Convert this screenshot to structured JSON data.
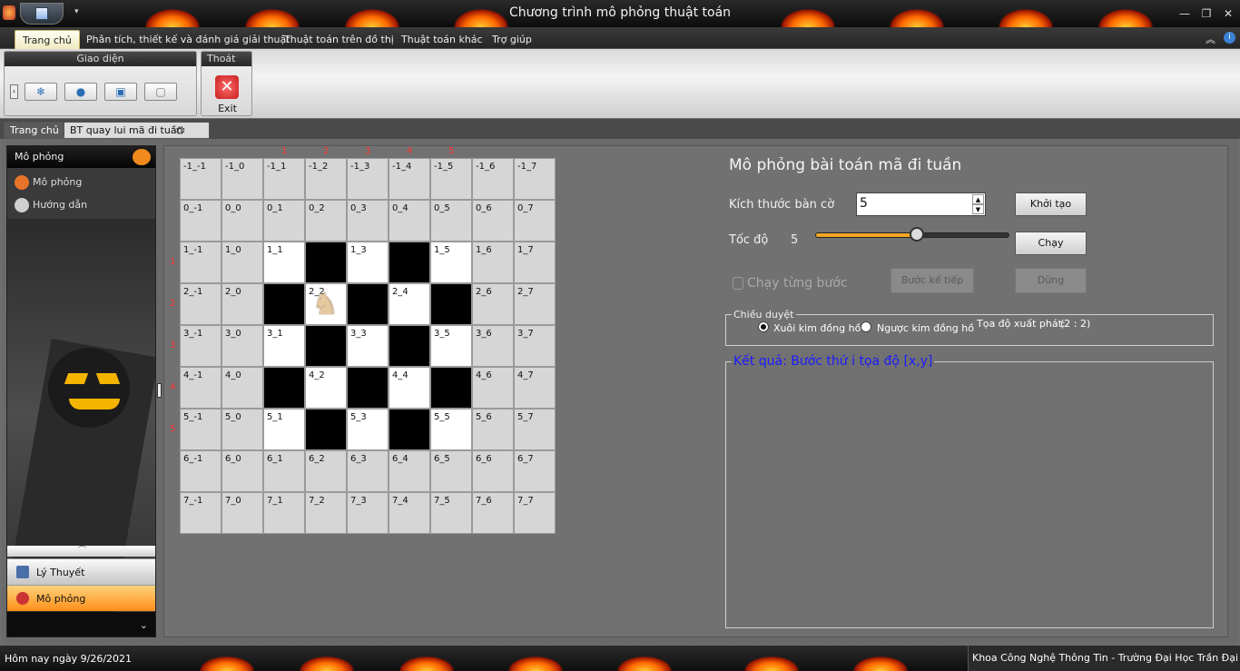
{
  "window": {
    "title": "Chương trình mô phỏng thuật toán"
  },
  "ribbon": {
    "tabs": [
      "Trang chủ",
      "Phân tích, thiết kế và đánh giá giải thuật",
      "Thuật toán trên đồ thị",
      "Thuật toán khác",
      "Trợ giúp"
    ],
    "group_interface": "Giao diện",
    "group_exit": "Thoát",
    "exit_label": "Exit"
  },
  "doc_tabs": [
    "Trang chủ",
    "BT quay lui mã đi tuần"
  ],
  "sidebar": {
    "header": "Mô phỏng",
    "items": [
      "Mô phỏng",
      "Hướng dẫn"
    ],
    "bottom_items": [
      "Lý Thuyết",
      "Mô phỏng"
    ]
  },
  "board": {
    "size": 5,
    "knight_row": 2,
    "knight_col": 2,
    "row_numbers": [
      "1",
      "2",
      "3",
      "4",
      "5"
    ],
    "col_numbers": [
      "1",
      "2",
      "3",
      "4",
      "5"
    ]
  },
  "panel": {
    "title": "Mô phỏng bài toán mã đi tuần",
    "size_label": "Kích thước bàn cờ",
    "size_value": "5",
    "init_button": "Khởi tạo",
    "speed_label": "Tốc độ",
    "speed_value": "5",
    "speed_fraction": 0.52,
    "run_button": "Chạy",
    "step_check": "Chạy từng bước",
    "next_button": "Bước kế tiếp",
    "stop_button": "Dừng",
    "direction_legend": "Chiều duyệt",
    "clockwise": "Xuôi kim đồng hồ",
    "counterclockwise": "Ngược kim đồng hồ",
    "start_label": "Tọa độ xuất phát:",
    "start_value": "(2 : 2)",
    "result_legend": "Kết quả: Bước thứ i tọa độ [x,y]"
  },
  "status": {
    "left": "Hôm nay ngày 9/26/2021",
    "right": "Khoa Công Nghệ Thông Tin - Trường Đại Học Trần Đại Nghĩa"
  },
  "colors": {
    "accent": "#ff9a1a",
    "board_black": "#000000",
    "board_white": "#ffffff",
    "outside": "#d6d6d6",
    "result_text": "#1a1aff"
  }
}
